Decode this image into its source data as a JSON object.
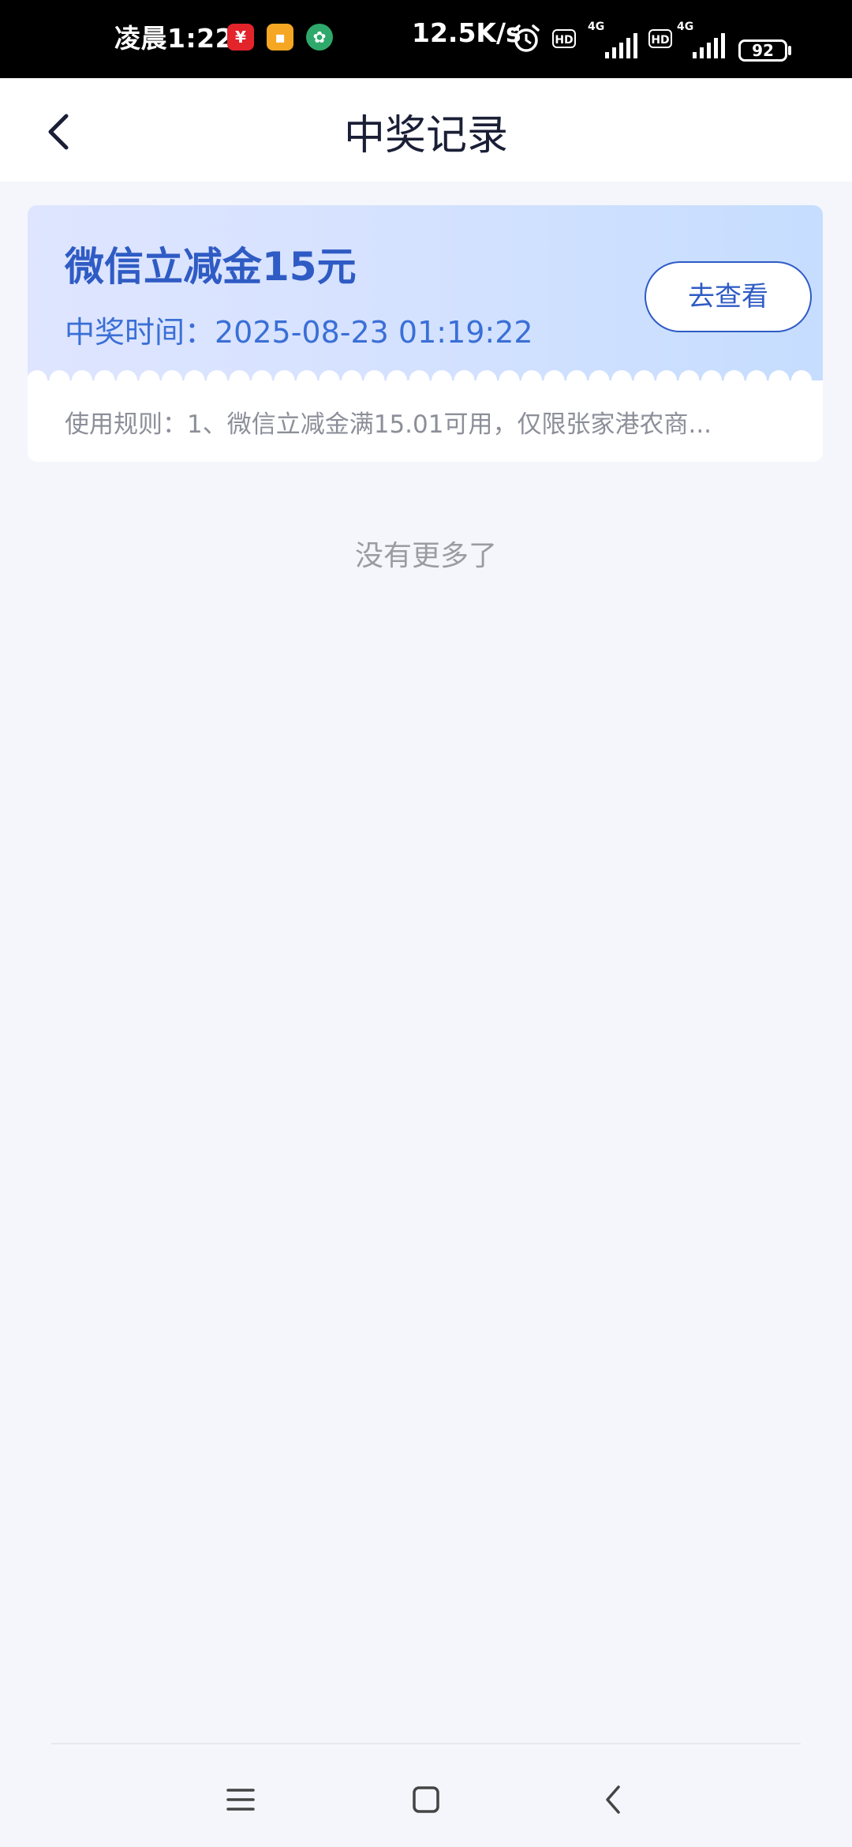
{
  "status_bar": {
    "time": "凌晨1:22",
    "net_speed": "12.5K/s",
    "battery": "92",
    "network_label_1": "4G",
    "network_label_2": "4G",
    "hd_label": "HD",
    "icons": [
      "app-notification-icon-red",
      "app-notification-icon-orange",
      "app-notification-icon-green",
      "alarm-icon",
      "hd-badge-icon",
      "signal-icon",
      "hd-badge-icon",
      "signal-icon",
      "battery-icon"
    ]
  },
  "header": {
    "title": "中奖记录",
    "back_icon": "chevron-left-icon"
  },
  "records": [
    {
      "title": "微信立减金15元",
      "time_label": "中奖时间：2025-08-23 01:19:22",
      "button_label": "去查看",
      "rules": "使用规则：1、微信立减金满15.01可用，仅限张家港农商..."
    }
  ],
  "footer_text": "没有更多了",
  "nav": {
    "icons": [
      "menu-icon",
      "home-square-icon",
      "back-chevron-icon"
    ]
  },
  "colors": {
    "accent": "#2f5bc4",
    "page_background": "#f4f6fb",
    "status_bar": "#000000"
  }
}
